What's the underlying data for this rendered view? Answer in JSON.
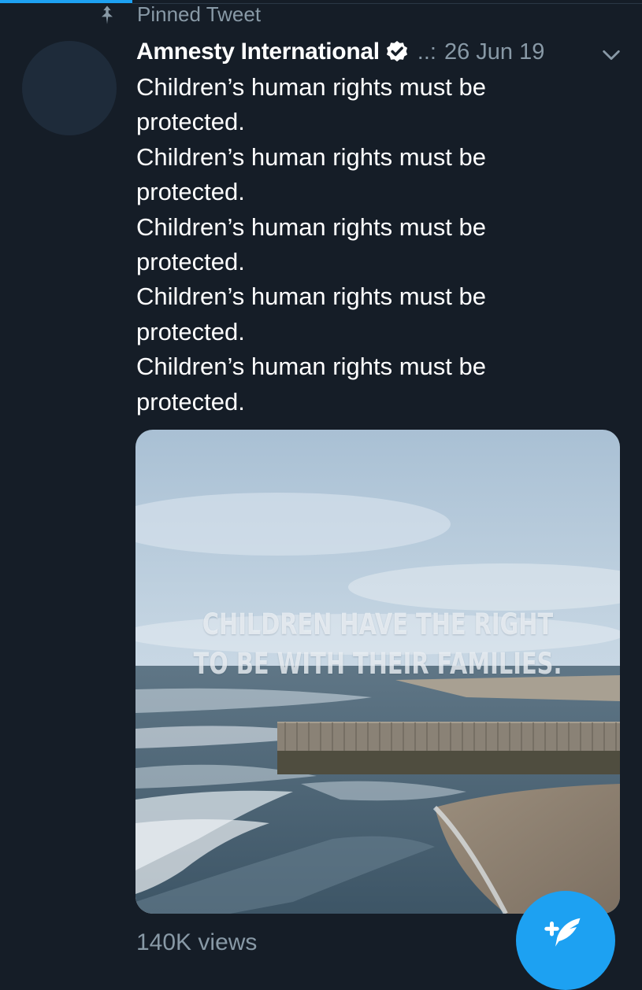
{
  "pinned": {
    "label": "Pinned Tweet",
    "icon": "pin-icon"
  },
  "tweet": {
    "author_name": "Amnesty International",
    "verified_icon": "verified-badge-icon",
    "handle_truncated": "..:",
    "date": "26 Jun 19",
    "more_icon": "chevron-down-icon",
    "text_lines": [
      "Children’s human rights must be",
      "protected.",
      "Children’s human rights must be",
      "protected.",
      "Children’s human rights must be",
      "protected.",
      "Children’s human rights must be",
      "protected.",
      "Children’s human rights must be",
      "protected."
    ],
    "media": {
      "overlay_line_1": "CHILDREN HAVE THE RIGHT",
      "overlay_line_2": "TO BE WITH THEIR FAMILIES."
    },
    "views": "140K views"
  },
  "compose": {
    "icon": "compose-tweet-icon"
  },
  "colors": {
    "background": "#151d27",
    "accent": "#1da1f2",
    "secondary_text": "#8899a6",
    "primary_text": "#ffffff"
  }
}
